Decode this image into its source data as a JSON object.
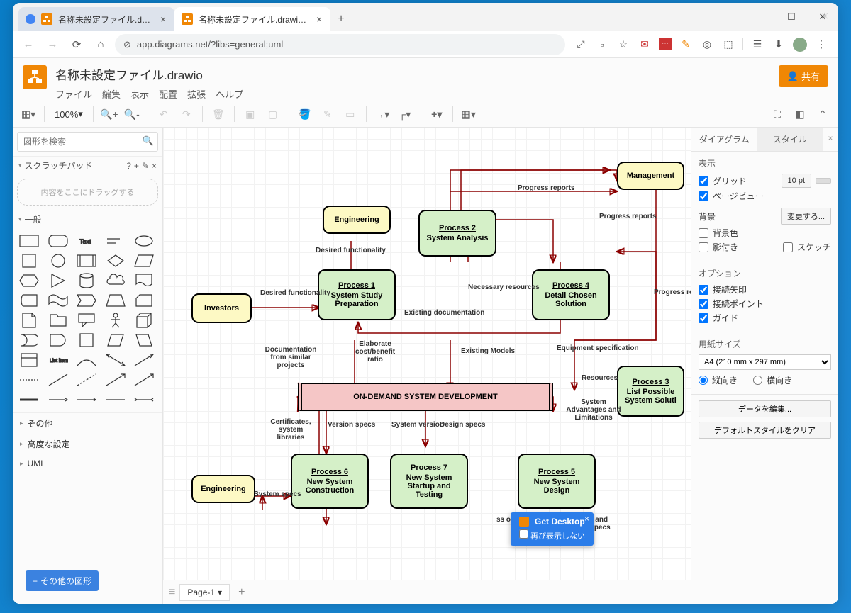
{
  "tabs": [
    {
      "title": "名称未設定ファイル.drawio - dra..."
    },
    {
      "title": "名称未設定ファイル.drawio - dra..."
    }
  ],
  "url": "app.diagrams.net/?libs=general;uml",
  "filename": "名称未設定ファイル.drawio",
  "menus": [
    "ファイル",
    "編集",
    "表示",
    "配置",
    "拡張",
    "ヘルプ"
  ],
  "share": "共有",
  "zoom": "100%",
  "search_ph": "図形を検索",
  "scratchpad": "スクラッチパッド",
  "drop_hint": "内容をここにドラッグする",
  "cat_general": "一般",
  "cat_other": "その他",
  "cat_adv": "高度な設定",
  "cat_uml": "UML",
  "more_shapes": "その他の図形",
  "page": "Page-1",
  "diagram": {
    "center": "ON-DEMAND SYSTEM DEVELOPMENT",
    "nodes": {
      "investors": "Investors",
      "eng1": "Engineering",
      "eng2": "Engineering",
      "mgmt": "Management",
      "p1t": "Process 1",
      "p1": "System Study Preparation",
      "p2t": "Process 2",
      "p2": "System Analysis",
      "p3t": "Process 3",
      "p3": "List Possible System Soluti",
      "p4t": "Process 4",
      "p4": "Detail Chosen Solution",
      "p5t": "Process 5",
      "p5": "New System Design",
      "p6t": "Process 6",
      "p6": "New System Construction",
      "p7t": "Process 7",
      "p7": "New System Startup and Testing"
    },
    "labels": {
      "l1": "Desired functionality",
      "l1b": "Desired functionality",
      "l2": "Progress reports",
      "l2b": "Progress reports",
      "l2c": "Progress reports",
      "l3": "Necessary resources",
      "l4": "Existing documentation",
      "l5": "Documentation from similar projects",
      "l6": "Elaborate cost/benefit ratio",
      "l7": "Existing Models",
      "l8": "Equipment specification",
      "l9": "Resources",
      "l10": "System Advantages and Limitations",
      "l11": "Certificates, system libraries",
      "l12": "Version specs",
      "l13": "System version",
      "l14": "Design specs",
      "l15": "System specs",
      "l16": "Hardware and Software specs",
      "l17": "ss orts"
    }
  },
  "rpanel": {
    "tab1": "ダイアグラム",
    "tab2": "スタイル",
    "view": "表示",
    "grid": "グリッド",
    "gridpt": "10 pt",
    "pageview": "ページビュー",
    "bg": "背景",
    "change": "変更する...",
    "bgcolor": "背景色",
    "shadow": "影付き",
    "sketch": "スケッチ",
    "opt": "オプション",
    "carrow": "接続矢印",
    "cpoint": "接続ポイント",
    "guide": "ガイド",
    "papersize": "用紙サイズ",
    "paper": "A4 (210 mm x 297 mm)",
    "port": "縦向き",
    "land": "横向き",
    "editdata": "データを編集...",
    "clearstyle": "デフォルトスタイルをクリア"
  },
  "popup": {
    "title": "Get Desktop",
    "again": "再び表示しない"
  }
}
